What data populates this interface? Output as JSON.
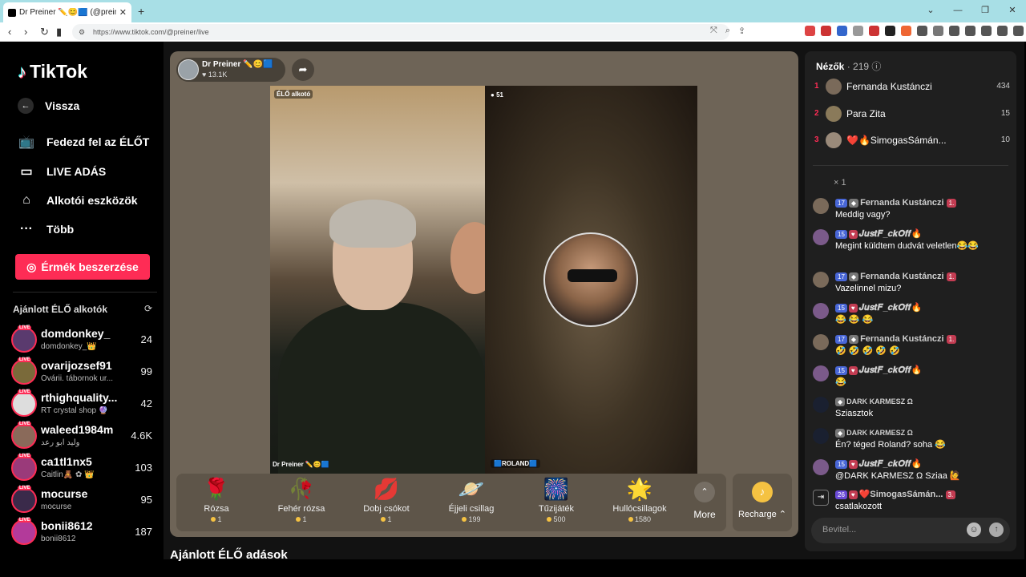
{
  "browser": {
    "tab_title": "Dr Preiner ✏️😊🟦 (@preine",
    "url": "https://www.tiktok.com/@preiner/live"
  },
  "sidebar": {
    "logo": "TikTok",
    "back": "Vissza",
    "nav": [
      {
        "label": "Fedezd fel az ÉLŐT",
        "icon": "live-discover-icon"
      },
      {
        "label": "LIVE ADÁS",
        "icon": "camera-icon"
      },
      {
        "label": "Alkotói eszközök",
        "icon": "creator-tools-icon"
      },
      {
        "label": "Több",
        "icon": "more-dots-icon"
      }
    ],
    "coins_button": "Érmék beszerzése",
    "recommended_heading": "Ajánlott ÉLŐ alkotók",
    "recommended": [
      {
        "name": "domdonkey_",
        "sub": "domdonkey_👑",
        "count": "24"
      },
      {
        "name": "ovarijozsef91",
        "sub": "Óvárii. tábornok ur...",
        "count": "99"
      },
      {
        "name": "rthighquality...",
        "sub": "RT crystal shop 🔮",
        "count": "42"
      },
      {
        "name": "waleed1984m",
        "sub": "وليد ابو رعد",
        "count": "4.6K"
      },
      {
        "name": "ca1tl1nx5",
        "sub": "Caitlin🧸 ✿ 👑",
        "count": "103"
      },
      {
        "name": "mocurse",
        "sub": "mocurse",
        "count": "95"
      },
      {
        "name": "bonii8612",
        "sub": "bonii8612",
        "count": "187"
      }
    ],
    "live_badge": "LIVE"
  },
  "stage": {
    "host_name": "Dr Preiner ✏️😊🟦",
    "host_likes": "♥ 13.1K",
    "left_tag": "ÉLŐ alkotó",
    "left_name": "Dr Preiner ✏️😊🟦",
    "right_count": "51",
    "right_name": "🟦ROLAND🟦",
    "gifts": [
      {
        "name": "Rózsa",
        "price": "1",
        "icon": "🌹"
      },
      {
        "name": "Fehér rózsa",
        "price": "1",
        "icon": "🥀"
      },
      {
        "name": "Dobj csókot",
        "price": "1",
        "icon": "💋"
      },
      {
        "name": "Éjjeli csillag",
        "price": "199",
        "icon": "🪐"
      },
      {
        "name": "Tűzijáték",
        "price": "500",
        "icon": "🎆"
      },
      {
        "name": "Hullócsillagok",
        "price": "1580",
        "icon": "🌟"
      }
    ],
    "more_label": "More",
    "recharge_label": "Recharge ⌃"
  },
  "recommended_lives_heading": "Ajánlott ÉLŐ adások",
  "chat": {
    "viewers_label": "Nézők",
    "viewers_count": "· 219",
    "top_viewers": [
      {
        "rank": "1",
        "name": "Fernanda Kustánczi",
        "count": "434"
      },
      {
        "rank": "2",
        "name": "Para Zita",
        "count": "15"
      },
      {
        "rank": "3",
        "name": "❤️🔥SimogasSámán...",
        "count": "10"
      }
    ],
    "x1": "× 1",
    "messages": [
      {
        "lvl": "17",
        "name": "Fernanda Kustánczi",
        "rank": "1.",
        "text": "Meddig vagy?"
      },
      {
        "lvl": "15",
        "name": "𝑱𝒖𝒔𝒕𝑭_𝒄𝒌𝑶𝒇𝒇🔥",
        "rank": "",
        "text": "Megint küldtem dudvát veletlen😂😂"
      },
      {
        "lvl": "17",
        "name": "Fernanda Kustánczi",
        "rank": "1.",
        "text": "Vazelinnel mizu?"
      },
      {
        "lvl": "15",
        "name": "𝑱𝒖𝒔𝒕𝑭_𝒄𝒌𝑶𝒇𝒇🔥",
        "rank": "",
        "text": "😂 😂 😂"
      },
      {
        "lvl": "17",
        "name": "Fernanda Kustánczi",
        "rank": "1.",
        "text": "🤣 🤣 🤣 🤣 🤣"
      },
      {
        "lvl": "15",
        "name": "𝑱𝒖𝒔𝒕𝑭_𝒄𝒌𝑶𝒇𝒇🔥",
        "rank": "",
        "text": "😂"
      },
      {
        "lvl": "",
        "name": "DARK KARMESZ Ω",
        "rank": "",
        "text": "Sziasztok"
      },
      {
        "lvl": "",
        "name": "DARK KARMESZ Ω",
        "rank": "",
        "text": "Én? téged Roland? soha 😂"
      },
      {
        "lvl": "15",
        "name": "𝑱𝒖𝒔𝒕𝑭_𝒄𝒌𝑶𝒇𝒇🔥",
        "rank": "",
        "text": "@DARK KARMESZ Ω Sziaa 🙋"
      },
      {
        "lvl": "26",
        "name": "❤️SimogasSámán...",
        "rank": "3.",
        "text": "csatlakozott"
      }
    ],
    "input_placeholder": "Bevitel..."
  }
}
